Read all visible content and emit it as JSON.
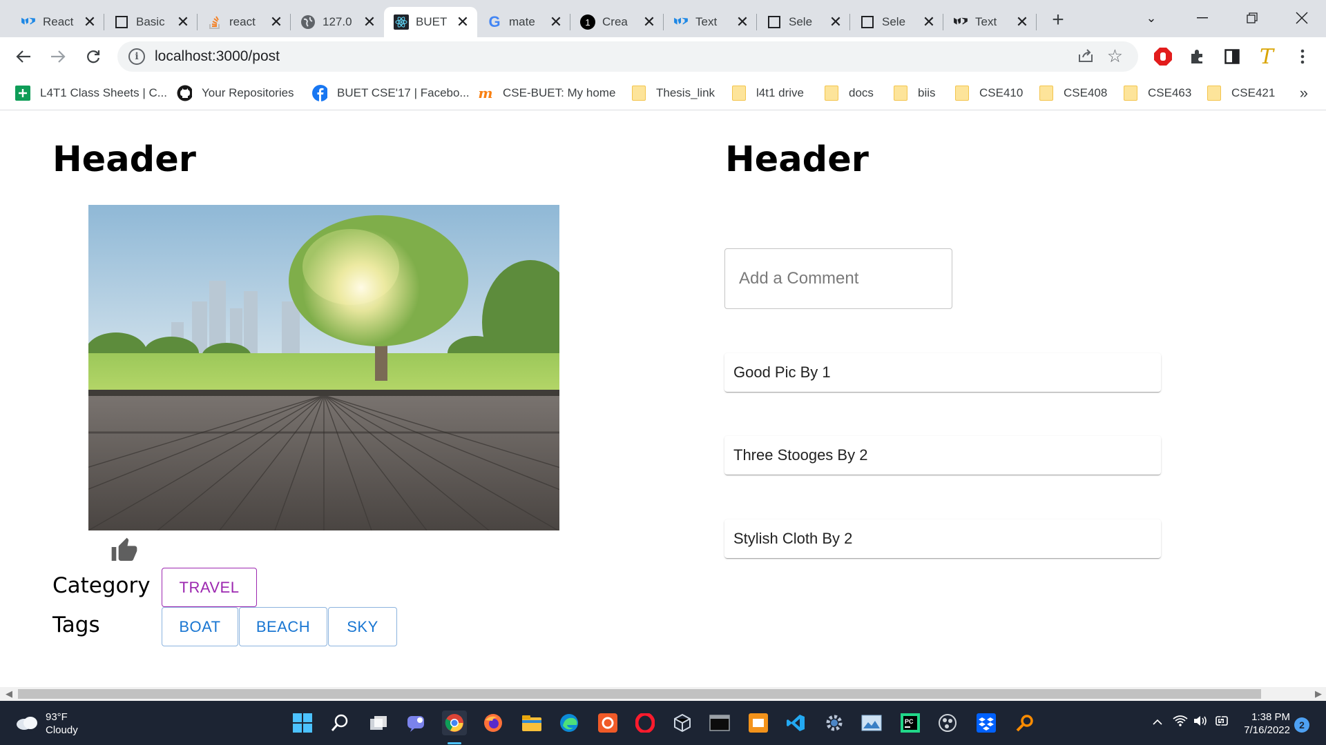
{
  "browser": {
    "tabs": [
      {
        "title": "React",
        "icon": "mui-icon"
      },
      {
        "title": "Basic",
        "icon": "page-icon"
      },
      {
        "title": "react",
        "icon": "stackoverflow-icon"
      },
      {
        "title": "127.0",
        "icon": "globe-icon"
      },
      {
        "title": "BUET",
        "icon": "react-icon",
        "active": true
      },
      {
        "title": "mate",
        "icon": "google-icon"
      },
      {
        "title": "Crea",
        "icon": "badge-one-icon"
      },
      {
        "title": "Text",
        "icon": "mui-icon"
      },
      {
        "title": "Sele",
        "icon": "page-icon"
      },
      {
        "title": "Sele",
        "icon": "page-icon"
      },
      {
        "title": "Text",
        "icon": "mui-icon"
      }
    ],
    "url": "localhost:3000/post",
    "bookmarks": [
      {
        "label": "L4T1 Class Sheets | C...",
        "icon": "sheets-icon"
      },
      {
        "label": "Your Repositories",
        "icon": "github-icon"
      },
      {
        "label": "BUET CSE'17 | Facebo...",
        "icon": "facebook-icon"
      },
      {
        "label": "CSE-BUET: My home",
        "icon": "moodle-icon"
      },
      {
        "label": "Thesis_link",
        "icon": "folder-icon"
      },
      {
        "label": "l4t1 drive",
        "icon": "folder-icon"
      },
      {
        "label": "docs",
        "icon": "folder-icon"
      },
      {
        "label": "biis",
        "icon": "folder-icon"
      },
      {
        "label": "CSE410",
        "icon": "folder-icon"
      },
      {
        "label": "CSE408",
        "icon": "folder-icon"
      },
      {
        "label": "CSE463",
        "icon": "folder-icon"
      },
      {
        "label": "CSE421",
        "icon": "folder-icon"
      }
    ],
    "more_bookmarks": "»"
  },
  "post": {
    "header": "Header",
    "category_label": "Category",
    "category": "TRAVEL",
    "tags_label": "Tags",
    "tags": [
      "BOAT",
      "BEACH",
      "SKY"
    ]
  },
  "comments": {
    "header": "Header",
    "placeholder": "Add a Comment",
    "items": [
      {
        "text": "Good Pic By 1"
      },
      {
        "text": "Three Stooges By 2"
      },
      {
        "text": "Stylish Cloth By 2"
      }
    ]
  },
  "taskbar": {
    "temperature": "93°F",
    "condition": "Cloudy",
    "time": "1:38 PM",
    "date": "7/16/2022",
    "notifications": "2"
  },
  "colors": {
    "category_chip": "#9c27b0",
    "tag_chip": "#1976d2",
    "taskbar": "#1c2433"
  }
}
